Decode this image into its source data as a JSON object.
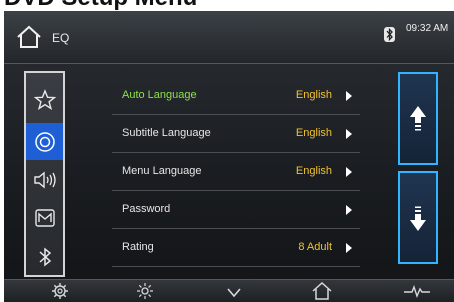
{
  "document": {
    "heading": "DVD Setup Menu"
  },
  "topbar": {
    "section_label": "EQ",
    "clock": "09:32 AM",
    "icons": {
      "home": "home-icon",
      "bluetooth": "bluetooth-icon"
    }
  },
  "sidebar": {
    "items": [
      {
        "icon": "star-icon",
        "active": false
      },
      {
        "icon": "disc-icon",
        "active": true
      },
      {
        "icon": "speaker-icon",
        "active": false
      },
      {
        "icon": "monitor-icon",
        "active": false
      },
      {
        "icon": "bluetooth-icon",
        "active": false
      }
    ]
  },
  "menu": {
    "rows": [
      {
        "label": "Auto Language",
        "value": "English",
        "highlighted": true
      },
      {
        "label": "Subtitle Language",
        "value": "English",
        "highlighted": false
      },
      {
        "label": "Menu Language",
        "value": "English",
        "highlighted": false
      },
      {
        "label": "Password",
        "value": "",
        "highlighted": false
      },
      {
        "label": "Rating",
        "value": "8 Adult",
        "highlighted": false
      }
    ]
  },
  "scroll": {
    "up_icon": "arrow-up-icon",
    "down_icon": "arrow-down-icon"
  },
  "bottombar": {
    "icons": [
      "settings-icon",
      "brightness-icon",
      "chevron-down-icon",
      "home-icon",
      "waveform-icon"
    ]
  },
  "colors": {
    "highlight_label": "#8de24a",
    "value_text": "#f2c12e",
    "active_item": "#1f5fd6",
    "scroll_border": "#33b4ff"
  }
}
